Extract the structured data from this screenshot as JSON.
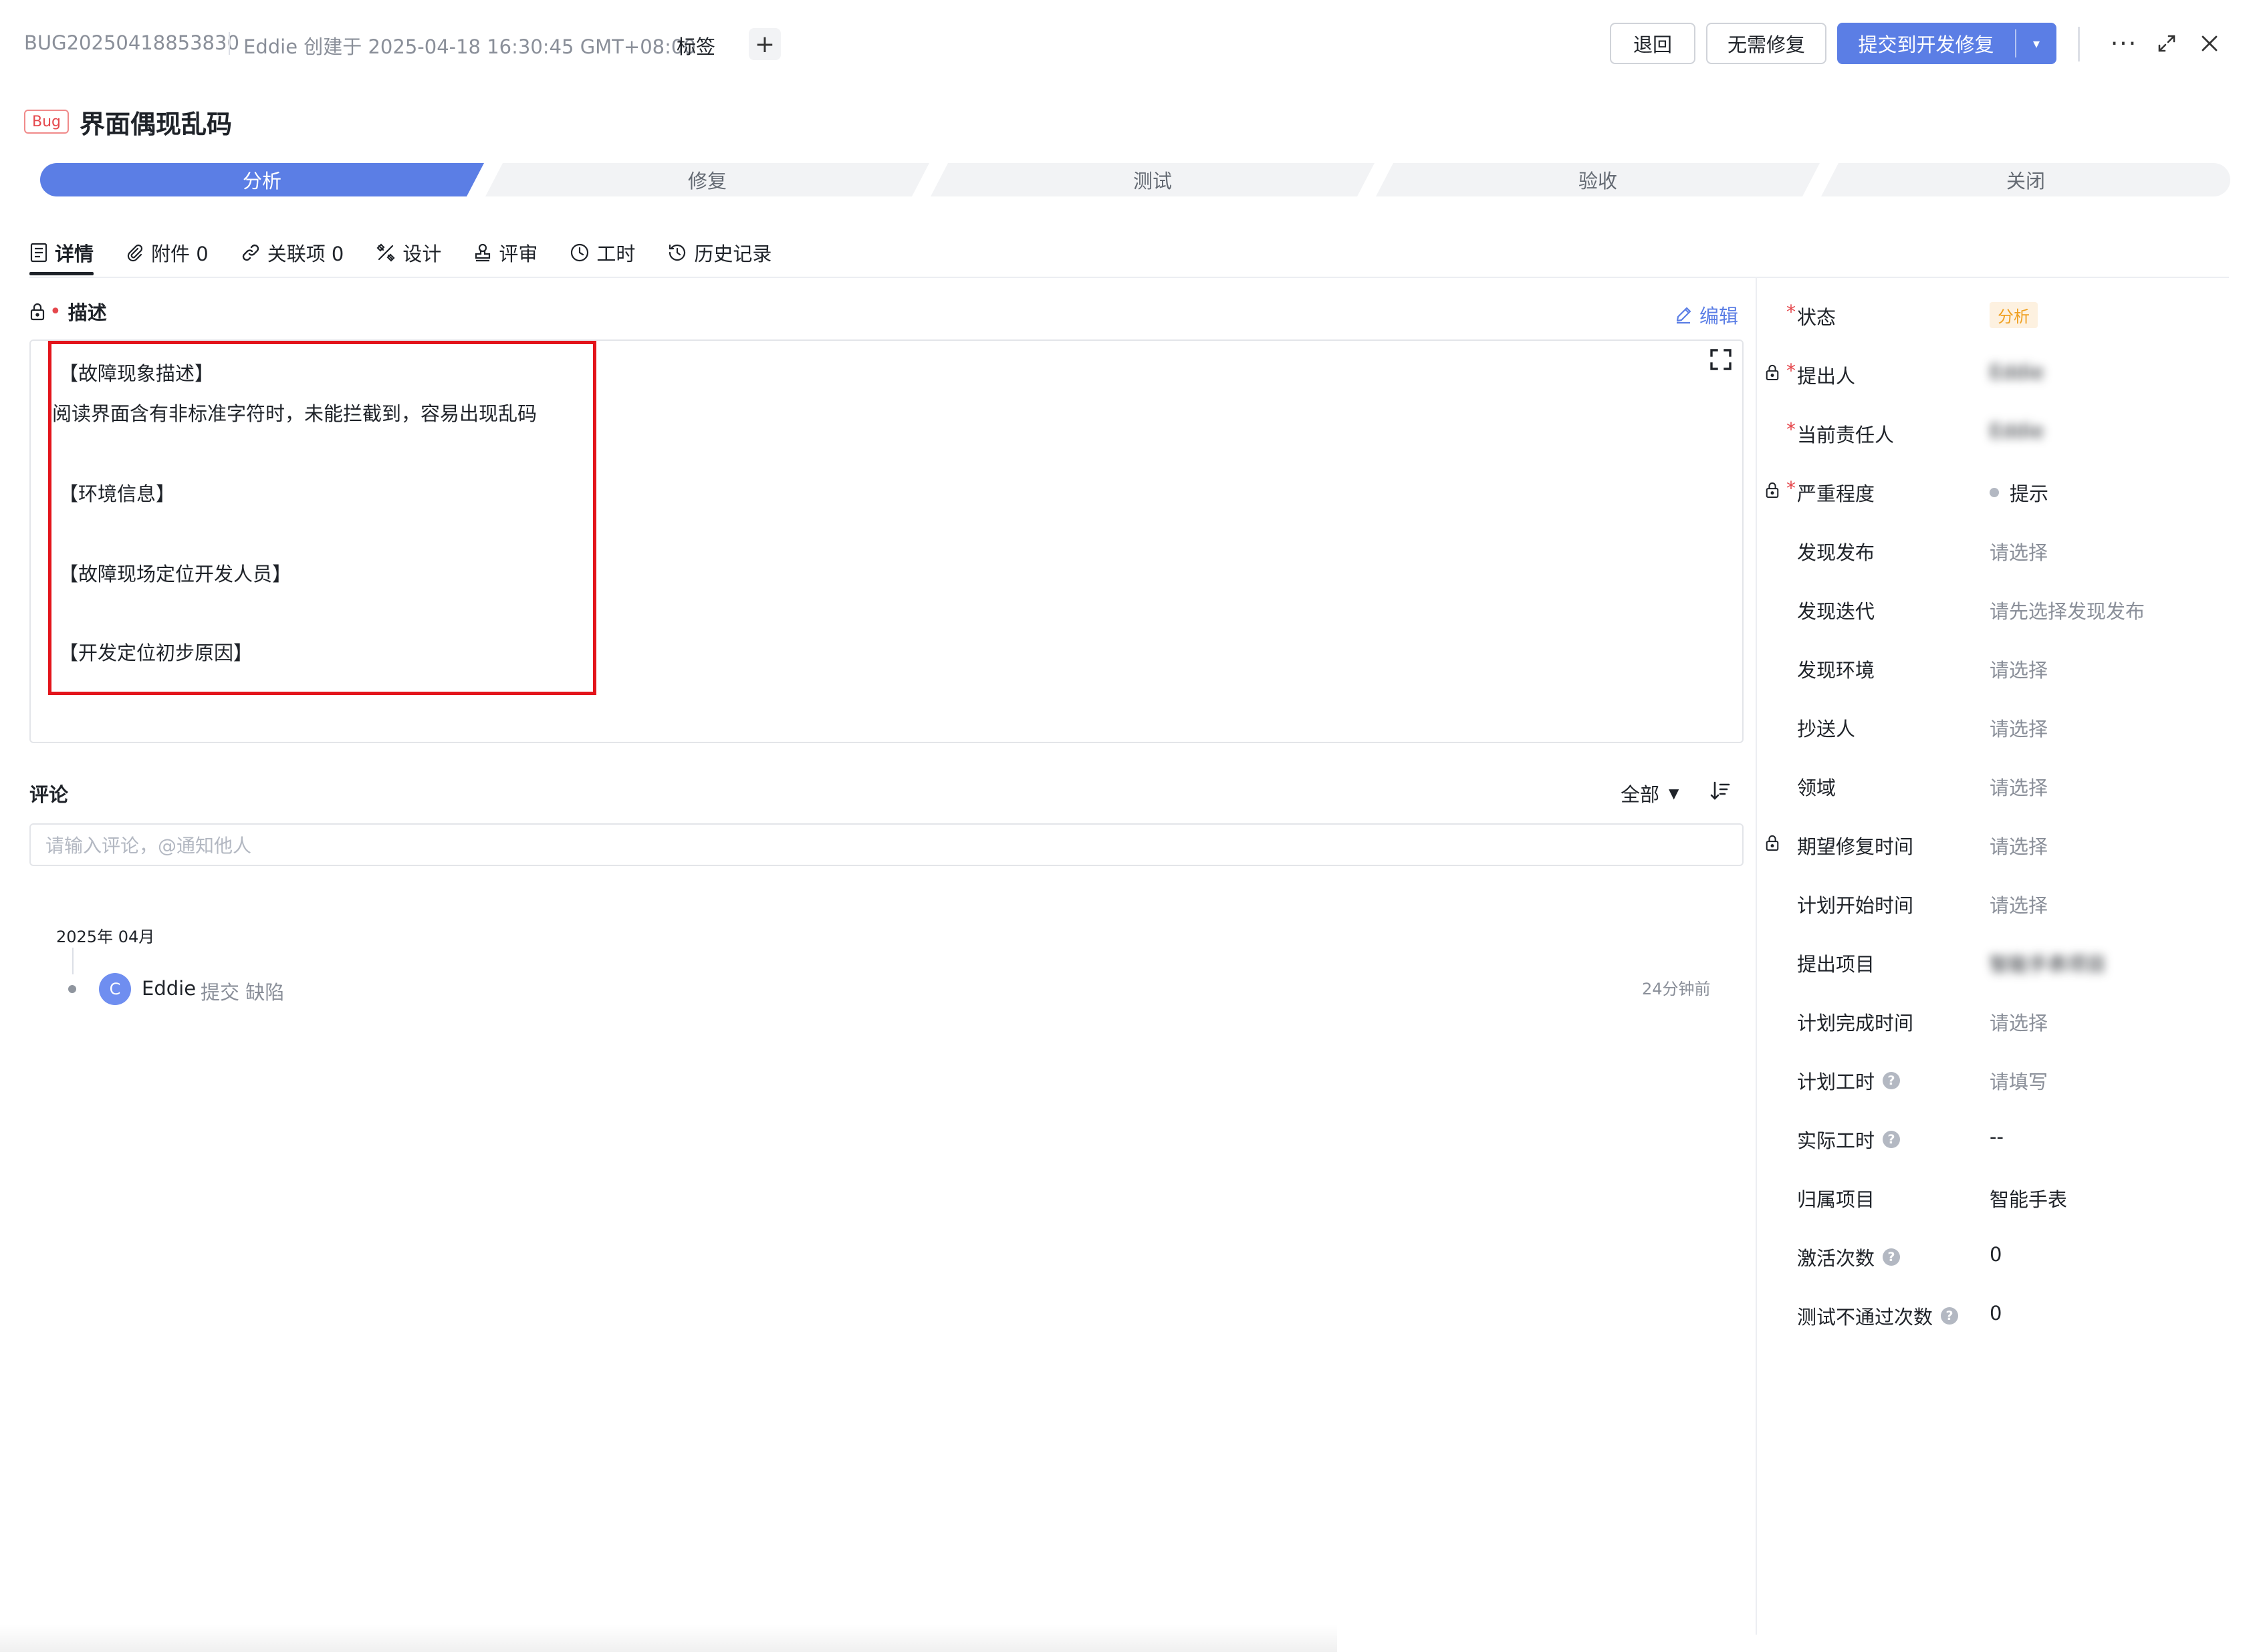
{
  "header": {
    "bug_id": "BUG20250418853830",
    "creator_info": "Eddie 创建于 2025-04-18 16:30:45 GMT+08:00",
    "tags_label": "标签",
    "tag_add": "+",
    "btn_back": "退回",
    "btn_no_fix": "无需修复",
    "btn_submit": "提交到开发修复",
    "btn_submit_caret": "▾",
    "more": "···"
  },
  "title": {
    "badge": "Bug",
    "text": "界面偶现乱码"
  },
  "stages": [
    "分析",
    "修复",
    "测试",
    "验收",
    "关闭"
  ],
  "tabs": [
    {
      "label": "详情"
    },
    {
      "label": "附件 0"
    },
    {
      "label": "关联项 0"
    },
    {
      "label": "设计"
    },
    {
      "label": "评审"
    },
    {
      "label": "工时"
    },
    {
      "label": "历史记录"
    }
  ],
  "description": {
    "label": "描述",
    "required_mark": "•",
    "edit_label": "编辑",
    "lines": [
      "【故障现象描述】",
      "阅读界面含有非标准字符时，未能拦截到，容易出现乱码",
      "【环境信息】",
      "【故障现场定位开发人员】",
      "【开发定位初步原因】"
    ]
  },
  "comments": {
    "title": "评论",
    "filter": "全部",
    "placeholder": "请输入评论，@通知他人",
    "month": "2025年 04月",
    "activity": {
      "avatar": "C",
      "user": "Eddie",
      "action": "提交 缺陷",
      "time": "24分钟前"
    }
  },
  "properties": [
    {
      "label": "状态",
      "required": "*",
      "lock": false,
      "value": "分析",
      "kind": "status"
    },
    {
      "label": "提出人",
      "required": "*",
      "lock": true,
      "value": "Eddie",
      "kind": "blur"
    },
    {
      "label": "当前责任人",
      "required": "*",
      "lock": false,
      "value": "Eddie",
      "kind": "blur"
    },
    {
      "label": "严重程度",
      "required": "*",
      "lock": true,
      "value": "提示",
      "kind": "severity"
    },
    {
      "label": "发现发布",
      "value": "请选择",
      "kind": "placeholder"
    },
    {
      "label": "发现迭代",
      "value": "请先选择发现发布",
      "kind": "placeholder"
    },
    {
      "label": "发现环境",
      "value": "请选择",
      "kind": "placeholder"
    },
    {
      "label": "抄送人",
      "value": "请选择",
      "kind": "placeholder"
    },
    {
      "label": "领域",
      "value": "请选择",
      "kind": "placeholder"
    },
    {
      "label": "期望修复时间",
      "lock": true,
      "value": "请选择",
      "kind": "placeholder"
    },
    {
      "label": "计划开始时间",
      "value": "请选择",
      "kind": "placeholder"
    },
    {
      "label": "提出项目",
      "value": "智能手表项目",
      "kind": "blur"
    },
    {
      "label": "计划完成时间",
      "value": "请选择",
      "kind": "placeholder"
    },
    {
      "label": "计划工时",
      "help": "?",
      "value": "请填写",
      "kind": "placeholder"
    },
    {
      "label": "实际工时",
      "help": "?",
      "value": "--",
      "kind": "text"
    },
    {
      "label": "归属项目",
      "value": "智能手表",
      "kind": "text"
    },
    {
      "label": "激活次数",
      "help": "?",
      "value": "0",
      "kind": "text"
    },
    {
      "label": "测试不通过次数",
      "help": "?",
      "value": "0",
      "kind": "text"
    }
  ],
  "colors": {
    "primary": "#5b7ee5",
    "danger": "#e5484d",
    "status_pill_text": "#f0a020",
    "highlight_box": "#e3141b"
  }
}
